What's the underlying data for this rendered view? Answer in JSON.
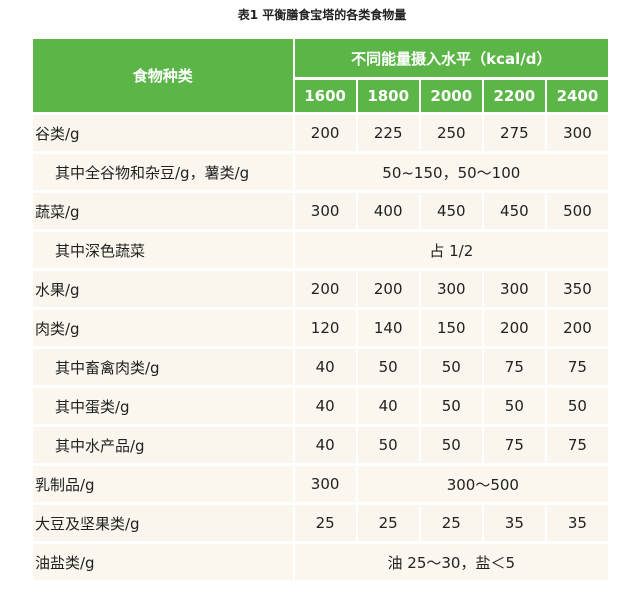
{
  "caption": "表1 平衡膳食宝塔的各类食物量",
  "header": {
    "name_col": "食物种类",
    "group": "不同能量摄入水平（kcal/d）",
    "levels": [
      "1600",
      "1800",
      "2000",
      "2200",
      "2400"
    ]
  },
  "rows": [
    {
      "name": "谷类/g",
      "sub": false,
      "values": [
        "200",
        "225",
        "250",
        "275",
        "300"
      ]
    },
    {
      "name": "其中全谷物和杂豆/g，薯类/g",
      "sub": true,
      "merged": "50~150，50～100"
    },
    {
      "name": "蔬菜/g",
      "sub": false,
      "values": [
        "300",
        "400",
        "450",
        "450",
        "500"
      ]
    },
    {
      "name": "其中深色蔬菜",
      "sub": true,
      "merged": "占 1/2"
    },
    {
      "name": "水果/g",
      "sub": false,
      "values": [
        "200",
        "200",
        "300",
        "300",
        "350"
      ]
    },
    {
      "name": "肉类/g",
      "sub": false,
      "values": [
        "120",
        "140",
        "150",
        "200",
        "200"
      ]
    },
    {
      "name": "其中畜禽肉类/g",
      "sub": true,
      "values": [
        "40",
        "50",
        "50",
        "75",
        "75"
      ]
    },
    {
      "name": "其中蛋类/g",
      "sub": true,
      "values": [
        "40",
        "40",
        "50",
        "50",
        "50"
      ]
    },
    {
      "name": "其中水产品/g",
      "sub": true,
      "values": [
        "40",
        "50",
        "50",
        "75",
        "75"
      ]
    },
    {
      "name": "乳制品/g",
      "sub": false,
      "first": "300",
      "merged_rest": "300～500"
    },
    {
      "name": "大豆及坚果类/g",
      "sub": false,
      "values": [
        "25",
        "25",
        "25",
        "35",
        "35"
      ]
    },
    {
      "name": "油盐类/g",
      "sub": false,
      "merged": "油 25～30，盐＜5"
    }
  ]
}
